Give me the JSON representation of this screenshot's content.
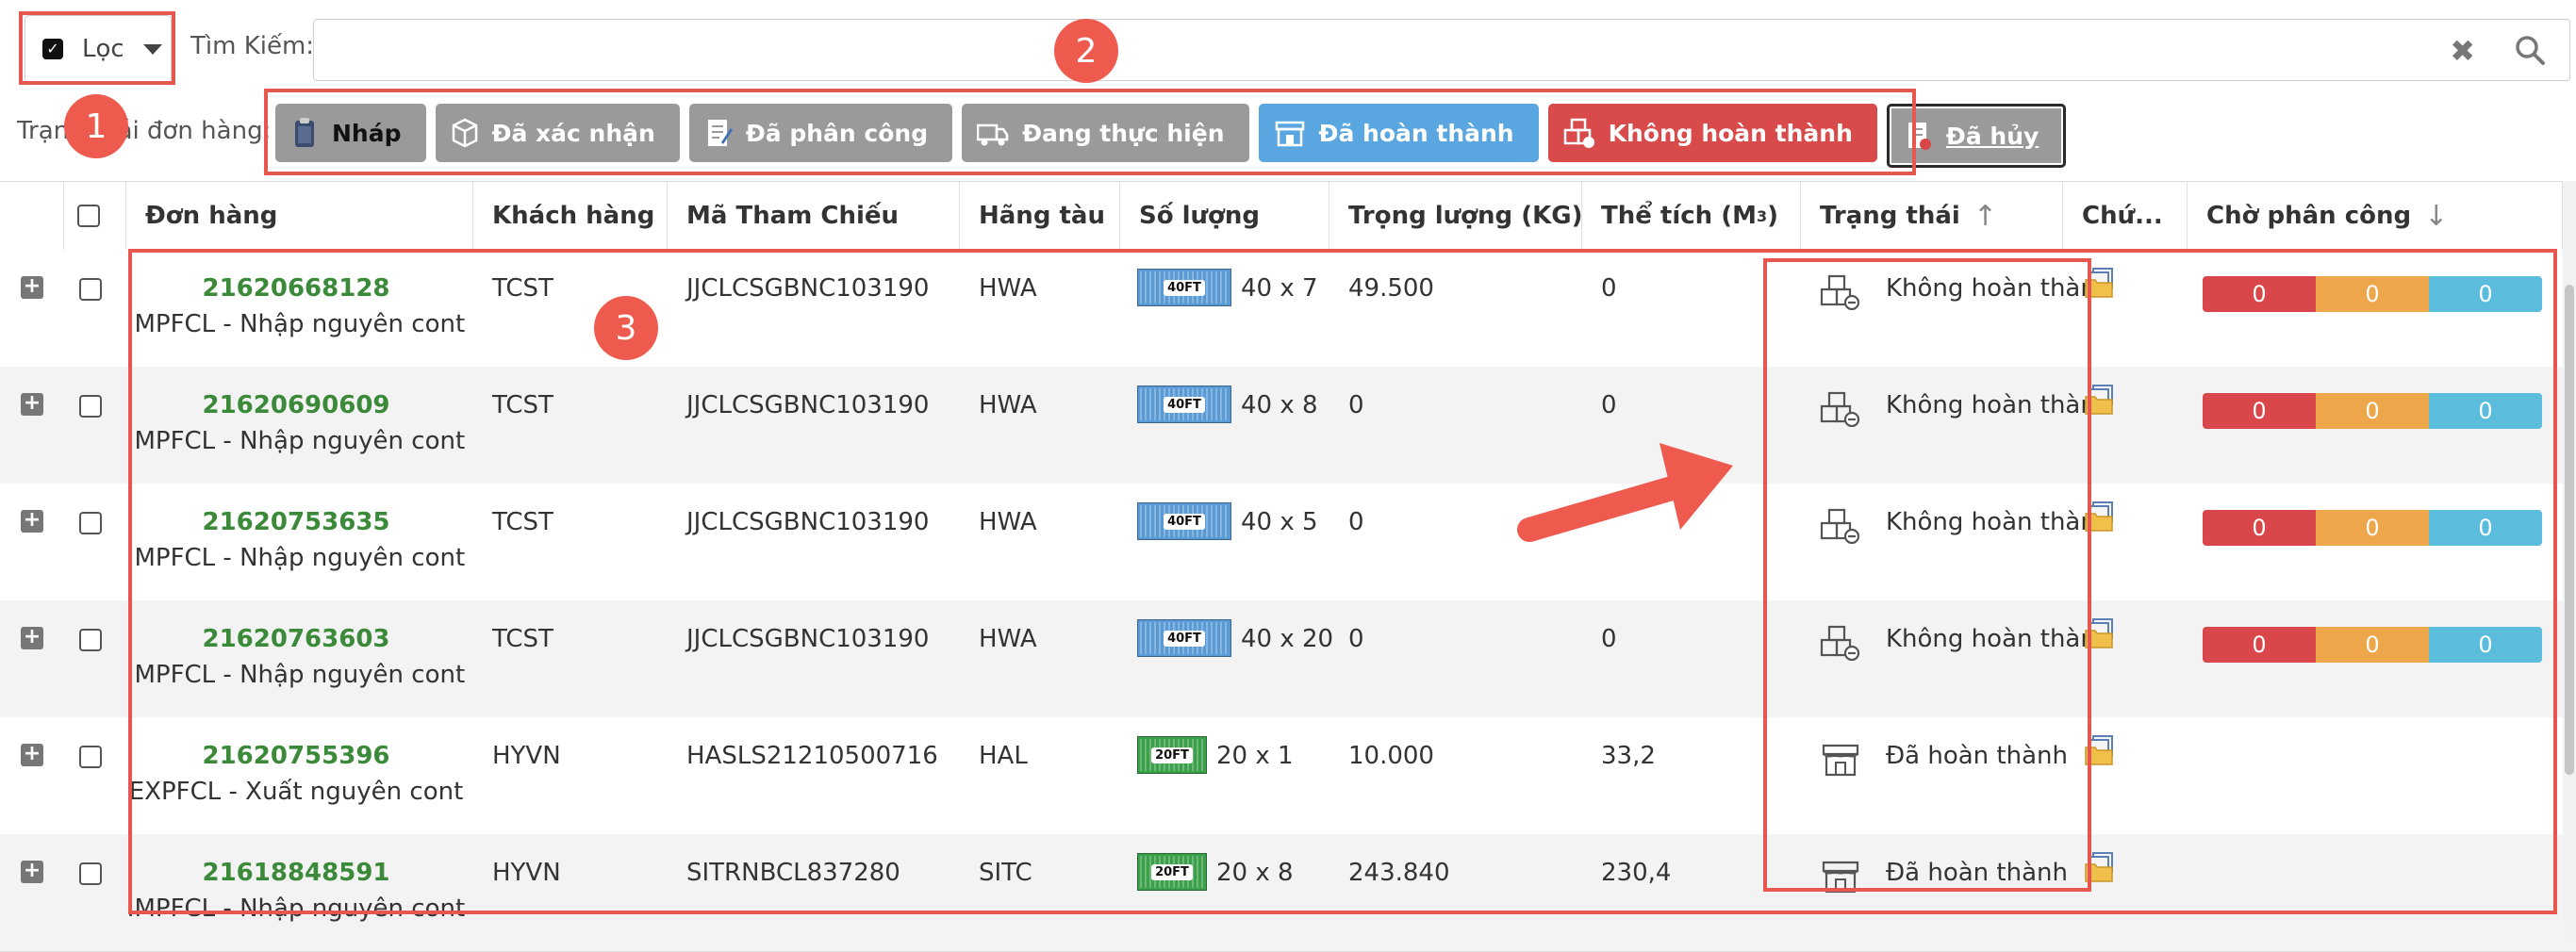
{
  "filter": {
    "label": "Lọc",
    "checked": true
  },
  "search": {
    "label": "Tìm Kiếm:",
    "value": "",
    "placeholder": ""
  },
  "status_filter": {
    "label": "Trạng thái đơn hàng:",
    "buttons": [
      {
        "label": "Nháp",
        "style": "draft"
      },
      {
        "label": "Đã xác nhận",
        "style": "gray"
      },
      {
        "label": "Đã phân công",
        "style": "gray"
      },
      {
        "label": "Đang thực hiện",
        "style": "gray"
      },
      {
        "label": "Đã hoàn thành",
        "style": "blue"
      },
      {
        "label": "Không hoàn thành",
        "style": "red"
      },
      {
        "label": "Đã hủy",
        "style": "cancel"
      }
    ]
  },
  "table": {
    "columns": {
      "order": "Đơn hàng",
      "customer": "Khách hàng",
      "reference": "Mã Tham Chiếu",
      "carrier": "Hãng tàu",
      "quantity": "Số lượng",
      "weight": "Trọng lượng (KG)",
      "volume": "Thể tích (M",
      "volume_sup": "3",
      "volume_close": ")",
      "status": "Trạng thái",
      "docs": "Chứ...",
      "pending": "Chờ phân công"
    },
    "rows": [
      {
        "order_id": "21620668128",
        "order_type": "IMPFCL - Nhập nguyên cont",
        "customer": "TCST",
        "reference": "JJCLCSGBNC103190",
        "carrier": "HWA",
        "container": "40FT",
        "quantity": "40 x 7",
        "weight": "49.500",
        "volume": "0",
        "status": "Không hoàn thành",
        "status_kind": "incomplete",
        "pending": [
          "0",
          "0",
          "0"
        ]
      },
      {
        "order_id": "21620690609",
        "order_type": "IMPFCL - Nhập nguyên cont",
        "customer": "TCST",
        "reference": "JJCLCSGBNC103190",
        "carrier": "HWA",
        "container": "40FT",
        "quantity": "40 x 8",
        "weight": "0",
        "volume": "0",
        "status": "Không hoàn thành",
        "status_kind": "incomplete",
        "pending": [
          "0",
          "0",
          "0"
        ]
      },
      {
        "order_id": "21620753635",
        "order_type": "IMPFCL - Nhập nguyên cont",
        "customer": "TCST",
        "reference": "JJCLCSGBNC103190",
        "carrier": "HWA",
        "container": "40FT",
        "quantity": "40 x 5",
        "weight": "0",
        "volume": "",
        "status": "Không hoàn thành",
        "status_kind": "incomplete",
        "pending": [
          "0",
          "0",
          "0"
        ]
      },
      {
        "order_id": "21620763603",
        "order_type": "IMPFCL - Nhập nguyên cont",
        "customer": "TCST",
        "reference": "JJCLCSGBNC103190",
        "carrier": "HWA",
        "container": "40FT",
        "quantity": "40 x 20",
        "weight": "0",
        "volume": "0",
        "status": "Không hoàn thành",
        "status_kind": "incomplete",
        "pending": [
          "0",
          "0",
          "0"
        ]
      },
      {
        "order_id": "21620755396",
        "order_type": "EXPFCL - Xuất nguyên cont",
        "customer": "HYVN",
        "reference": "HASLS21210500716",
        "carrier": "HAL",
        "container": "20FT",
        "quantity": "20 x 1",
        "weight": "10.000",
        "volume": "33,2",
        "status": "Đã hoàn thành",
        "status_kind": "complete",
        "pending": null
      },
      {
        "order_id": "21618848591",
        "order_type": "IMPFCL - Nhập nguyên cont",
        "customer": "HYVN",
        "reference": "SITRNBCL837280",
        "carrier": "SITC",
        "container": "20FT",
        "quantity": "20 x 8",
        "weight": "243.840",
        "volume": "230,4",
        "status": "Đã hoàn thành",
        "status_kind": "complete",
        "pending": null
      }
    ]
  },
  "annotations": [
    "1",
    "2",
    "3"
  ],
  "colors": {
    "annotation": "#e8574f",
    "order_id": "#3a8a3a",
    "container_40ft": "#5b9bd5",
    "container_20ft": "#3aa04a",
    "pending_red": "#d9474a",
    "pending_orange": "#eea64a",
    "pending_blue": "#5bbcdc"
  }
}
